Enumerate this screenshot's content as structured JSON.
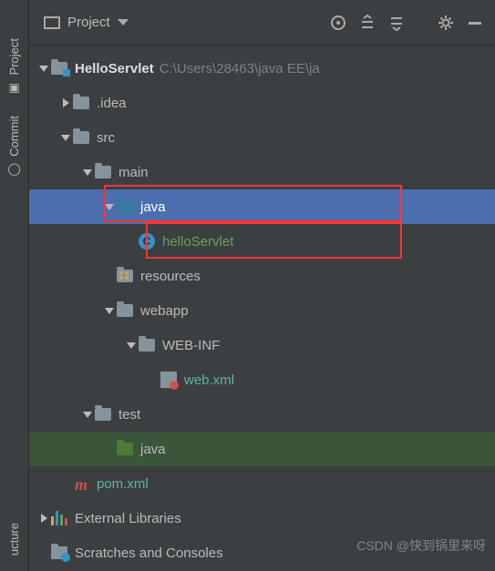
{
  "toolbar": {
    "project_label": "Project"
  },
  "sidebar": {
    "tabs": {
      "project": "Project",
      "commit": "Commit",
      "structure": "ucture"
    }
  },
  "tree": {
    "root": {
      "name": "HelloServlet",
      "path": "C:\\Users\\28463\\java EE\\ja"
    },
    "idea": ".idea",
    "src": "src",
    "main": "main",
    "java": "java",
    "helloServlet": "helloServlet",
    "resources": "resources",
    "webapp": "webapp",
    "webinf": "WEB-INF",
    "webxml": "web.xml",
    "test": "test",
    "test_java": "java",
    "pom": "pom.xml",
    "ext_libs": "External Libraries",
    "scratches": "Scratches and Consoles"
  },
  "watermark": "CSDN @快到锅里来呀"
}
